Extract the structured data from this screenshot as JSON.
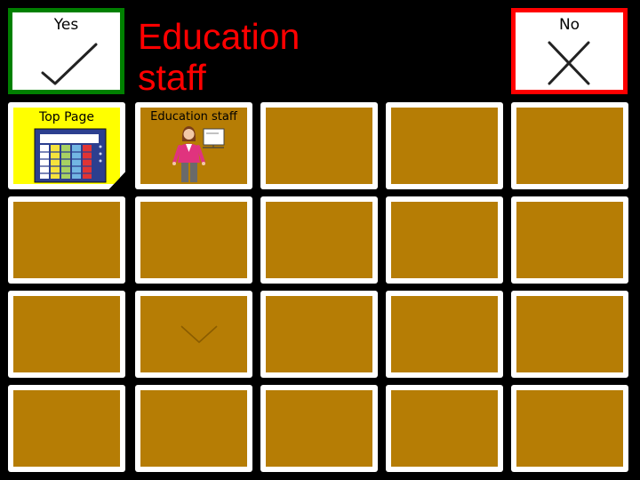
{
  "yes_button": {
    "label": "Yes",
    "icon": "checkmark-icon",
    "border_color": "#008000"
  },
  "no_button": {
    "label": "No",
    "icon": "cross-icon",
    "border_color": "#ff0000"
  },
  "page_title": "Education\nstaff",
  "colors": {
    "background": "#000000",
    "tile": "#b67d05",
    "top_page_tile": "#ffff00",
    "title": "#ff0000"
  },
  "grid": {
    "top_page": {
      "label": "Top Page",
      "icon": "grid-board-icon"
    },
    "education_staff": {
      "label": "Education staff",
      "icon": "teacher-icon"
    },
    "scroll_down": {
      "icon": "chevron-down-icon"
    }
  }
}
